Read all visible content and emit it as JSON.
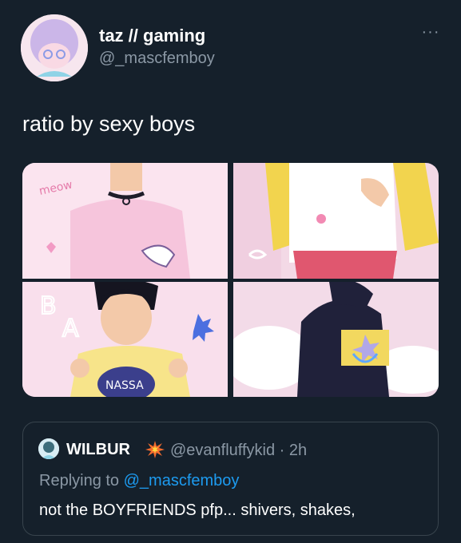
{
  "tweet": {
    "author": {
      "display_name": "taz // gaming",
      "handle": "@_mascfemboy",
      "avatar": "pastel-avatar-image"
    },
    "more_icon": "more-horizontal-icon",
    "text": "ratio by sexy boys",
    "media": {
      "panels": [
        {
          "name": "panel-top-left",
          "description_icon": "illustration",
          "sticker_text": "meow"
        },
        {
          "name": "panel-top-right",
          "description_icon": "illustration"
        },
        {
          "name": "panel-bottom-left",
          "description_icon": "illustration",
          "letters": [
            "B",
            "A"
          ],
          "shirt_text": "NASSA"
        },
        {
          "name": "panel-bottom-right",
          "description_icon": "illustration"
        }
      ]
    },
    "quote": {
      "display_name": "WILBUR",
      "badge_icon": "collision-emoji",
      "handle_time": "@evanfluffykid · 2h",
      "replying_prefix": "Replying to ",
      "replying_to": "@_mascfemboy",
      "text": "not the BOYFRIENDS pfp... shivers, shakes,"
    }
  },
  "colors": {
    "background": "#15202b",
    "secondary_text": "#8b98a5",
    "link": "#1d9bf0",
    "border": "#38444d"
  }
}
